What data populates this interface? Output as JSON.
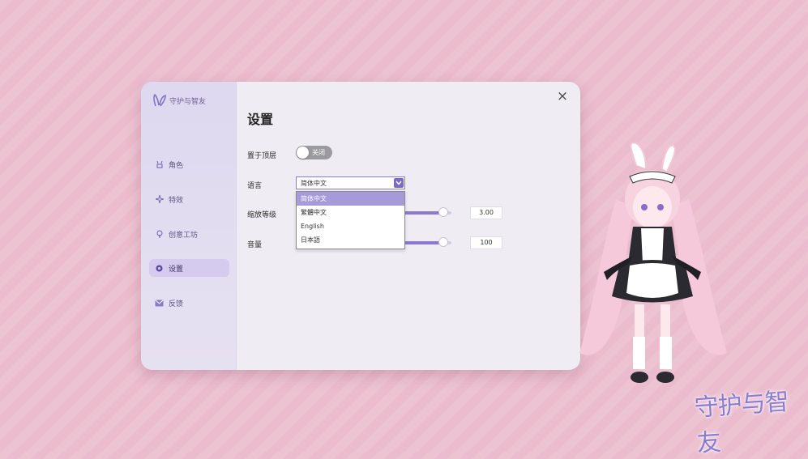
{
  "app": {
    "name": "守护与智友"
  },
  "sidebar": {
    "items": [
      {
        "label": "角色",
        "icon": "character-icon",
        "active": false
      },
      {
        "label": "特效",
        "icon": "sparkle-icon",
        "active": false
      },
      {
        "label": "创意工坊",
        "icon": "lightbulb-icon",
        "active": false
      },
      {
        "label": "设置",
        "icon": "settings-gear-icon",
        "active": true
      },
      {
        "label": "反馈",
        "icon": "mail-icon",
        "active": false
      }
    ]
  },
  "settings": {
    "title": "设置",
    "always_on_top": {
      "label": "置于顶层",
      "state_text": "关闭",
      "on": false
    },
    "language": {
      "label": "语言",
      "value": "简体中文",
      "options": [
        "简体中文",
        "繁體中文",
        "English",
        "日本語"
      ],
      "selected_index": 0
    },
    "zoom": {
      "label": "缩放等级",
      "value": "3.00",
      "fraction": 0.95
    },
    "volume": {
      "label": "音量",
      "value": "100",
      "fraction": 0.95
    }
  },
  "watermark": {
    "text": "守护与智友"
  },
  "colors": {
    "accent": "#8b78d2",
    "sidebar_active": "#d5cbee",
    "background": "#ebbccd"
  }
}
